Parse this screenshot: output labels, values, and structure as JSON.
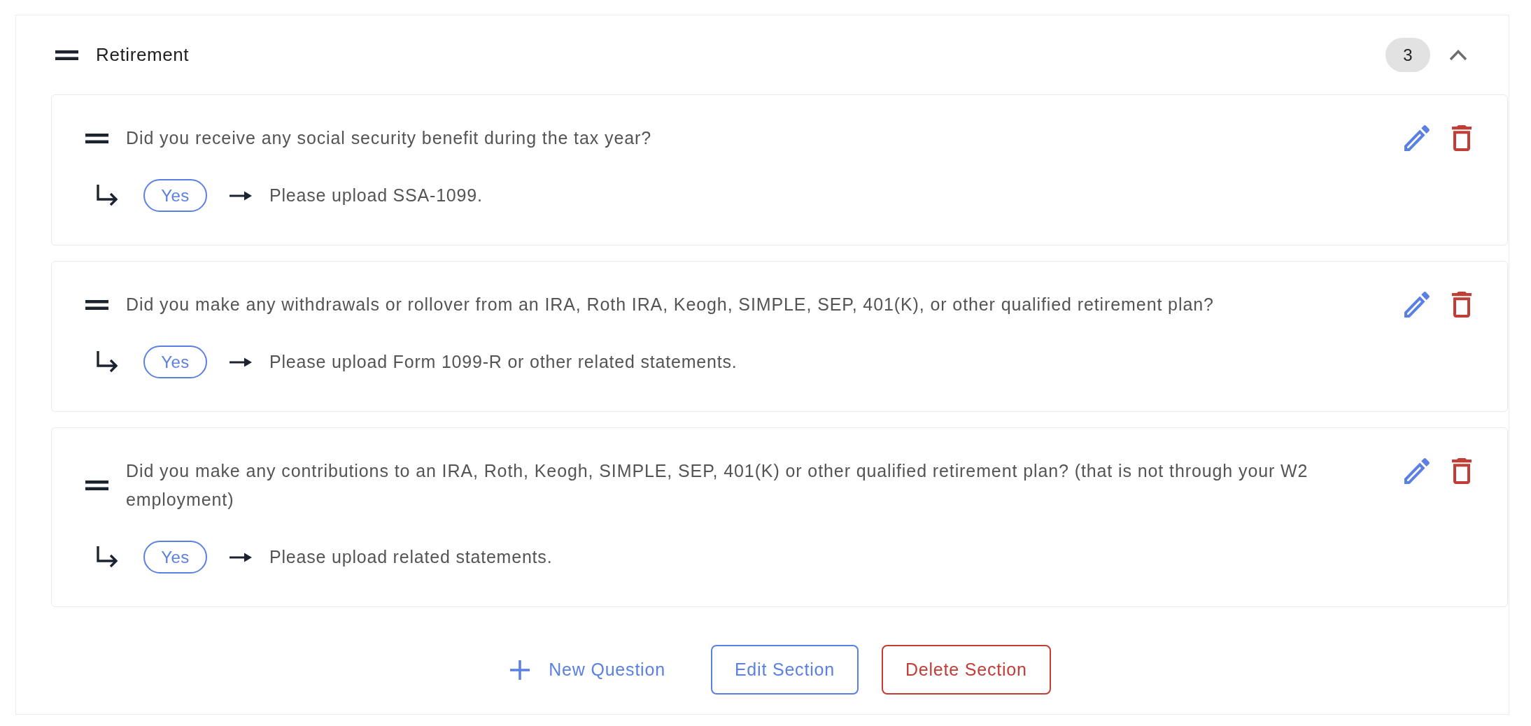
{
  "section": {
    "title": "Retirement",
    "count": "3",
    "expanded": true
  },
  "questions": [
    {
      "text": "Did you receive any social security benefit during the tax year?",
      "answer": "Yes",
      "action": "Please upload SSA-1099."
    },
    {
      "text": "Did you make any withdrawals or rollover from an IRA, Roth IRA, Keogh, SIMPLE, SEP, 401(K), or other qualified retirement plan?",
      "answer": "Yes",
      "action": "Please upload Form 1099-R or other related statements."
    },
    {
      "text": "Did you make any contributions to an IRA, Roth, Keogh, SIMPLE, SEP, 401(K) or other qualified retirement plan? (that is not through your W2 employment)",
      "answer": "Yes",
      "action": "Please upload related statements."
    }
  ],
  "actions": [
    {
      "kind": "add",
      "label": "New Question"
    },
    {
      "kind": "edit",
      "label": "Edit Section"
    },
    {
      "kind": "delete",
      "label": "Delete Section"
    }
  ]
}
